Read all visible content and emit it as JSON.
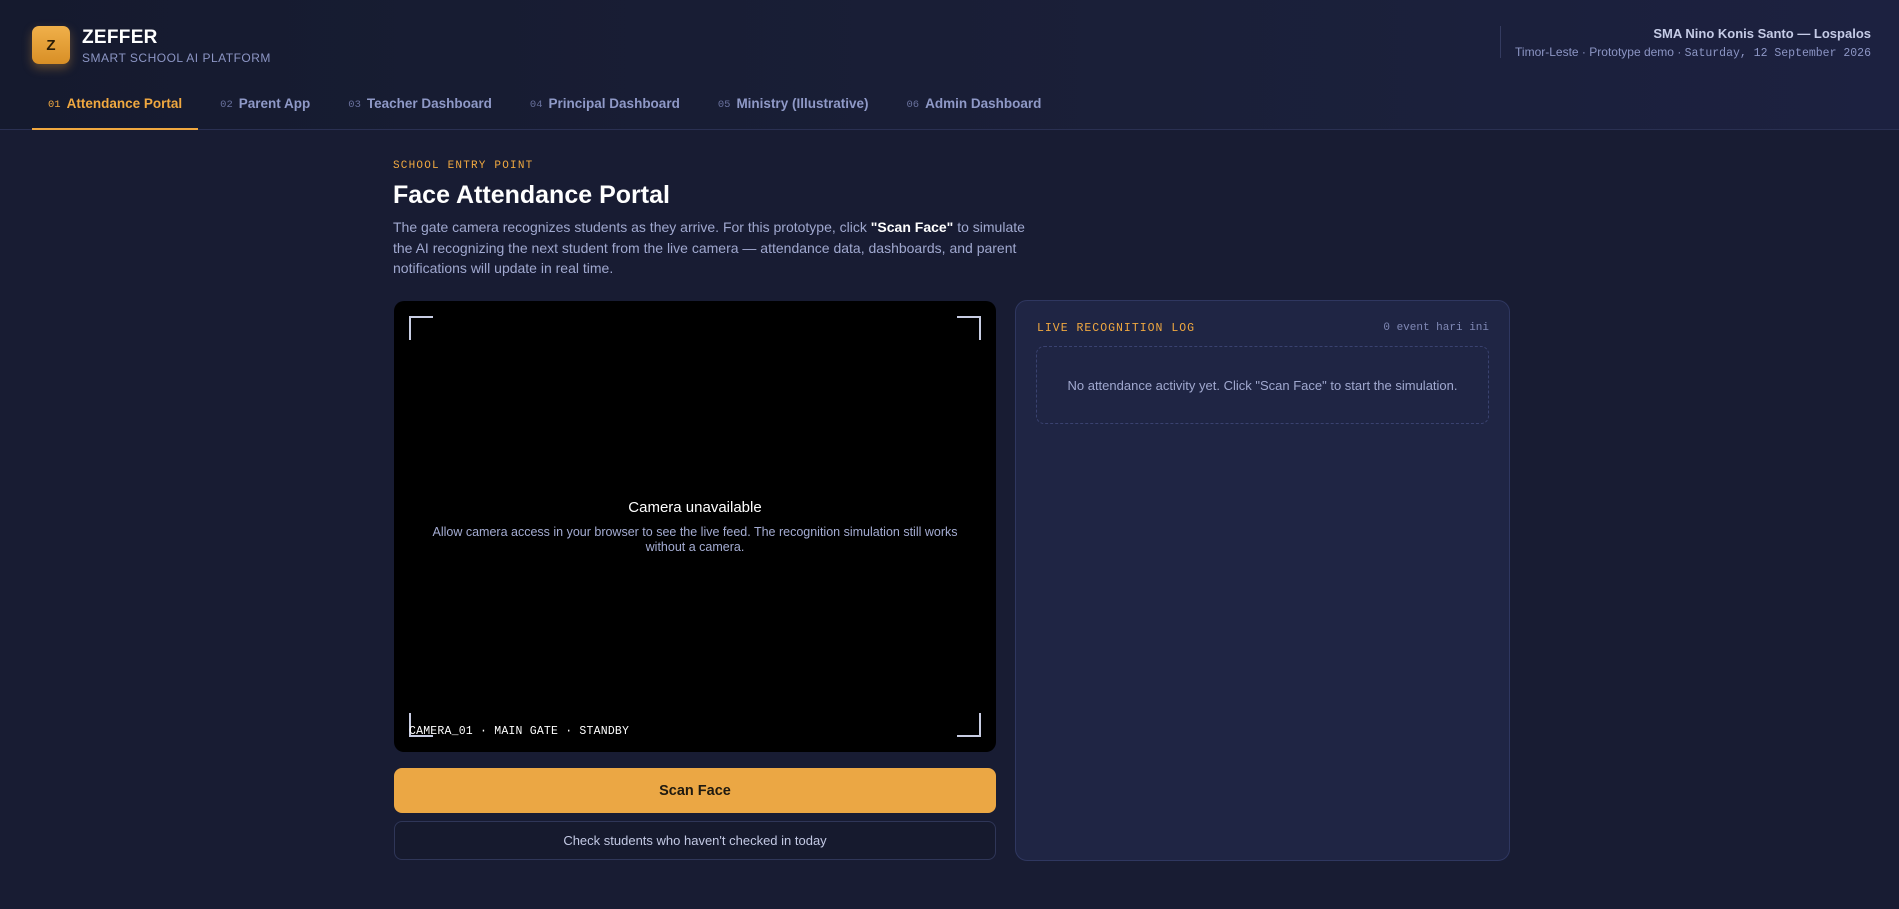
{
  "brand": {
    "logo_letter": "Z",
    "name": "ZEFFER",
    "subtitle": "SMART SCHOOL AI PLATFORM",
    "accent_color": "#f0a840"
  },
  "school": {
    "name": "SMA Nino Konis Santo — Lospalos",
    "meta_prefix": "Timor-Leste · Prototype demo · ",
    "date": "Saturday, 12 September 2026"
  },
  "nav": {
    "tabs": [
      {
        "num": "01",
        "label": "Attendance Portal",
        "active": true
      },
      {
        "num": "02",
        "label": "Parent App",
        "active": false
      },
      {
        "num": "03",
        "label": "Teacher Dashboard",
        "active": false
      },
      {
        "num": "04",
        "label": "Principal Dashboard",
        "active": false
      },
      {
        "num": "05",
        "label": "Ministry (Illustrative)",
        "active": false
      },
      {
        "num": "06",
        "label": "Admin Dashboard",
        "active": false
      }
    ]
  },
  "page": {
    "eyebrow": "SCHOOL ENTRY POINT",
    "title": "Face Attendance Portal",
    "intro_before": "The gate camera recognizes students as they arrive. For this prototype, click ",
    "intro_bold": "\"Scan Face\"",
    "intro_after": " to simulate the AI recognizing the next student from the live camera — attendance data, dashboards, and parent notifications will update in real time."
  },
  "camera": {
    "title": "Camera unavailable",
    "description": "Allow camera access in your browser to see the live feed. The recognition simulation still works without a camera.",
    "status": "CAMERA_01 · MAIN GATE · STANDBY"
  },
  "actions": {
    "scan_label": "Scan Face",
    "check_label": "Check students who haven't checked in today"
  },
  "log": {
    "title": "LIVE RECOGNITION LOG",
    "count": "0 event hari ini",
    "empty_message": "No attendance activity yet. Click \"Scan Face\" to start the simulation."
  }
}
